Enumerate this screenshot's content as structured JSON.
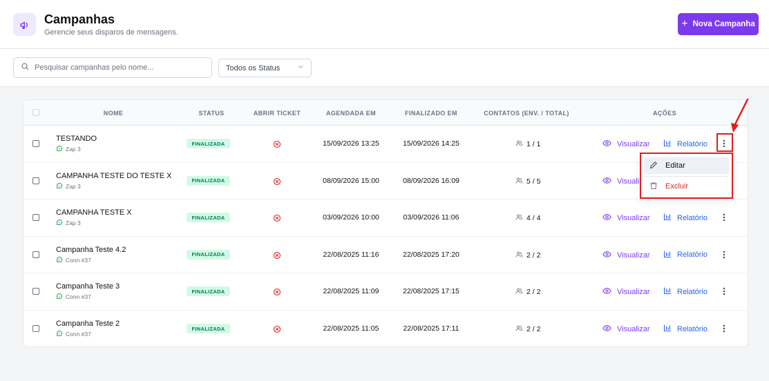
{
  "header": {
    "title": "Campanhas",
    "subtitle": "Gerencie seus disparos de mensagens.",
    "new_button": "Nova Campanha",
    "plus": "+"
  },
  "filters": {
    "search_placeholder": "Pesquisar campanhas pelo nome...",
    "status_value": "Todos os Status"
  },
  "table": {
    "columns": [
      "NOME",
      "STATUS",
      "ABRIR TICKET",
      "AGENDADA EM",
      "FINALIZADO EM",
      "CONTATOS (ENV. / TOTAL)",
      "AÇÕES"
    ],
    "view_label": "Visualizar",
    "report_label": "Relatório",
    "rows": [
      {
        "name": "TESTANDO",
        "connection": "Zap 3",
        "status": "FINALIZADA",
        "scheduled": "15/09/2026 13:25",
        "finished": "15/09/2026 14:25",
        "contacts": "1 / 1"
      },
      {
        "name": "CAMPANHA TESTE DO TESTE X",
        "connection": "Zap 3",
        "status": "FINALIZADA",
        "scheduled": "08/09/2026 15:00",
        "finished": "08/09/2026 16:09",
        "contacts": "5 / 5"
      },
      {
        "name": "CAMPANHA TESTE X",
        "connection": "Zap 3",
        "status": "FINALIZADA",
        "scheduled": "03/09/2026 10:00",
        "finished": "03/09/2026 11:06",
        "contacts": "4 / 4"
      },
      {
        "name": "Campanha Teste 4.2",
        "connection": "Conn #37",
        "status": "FINALIZADA",
        "scheduled": "22/08/2025 11:16",
        "finished": "22/08/2025 17:20",
        "contacts": "2 / 2"
      },
      {
        "name": "Campanha Teste 3",
        "connection": "Conn #37",
        "status": "FINALIZADA",
        "scheduled": "22/08/2025 11:09",
        "finished": "22/08/2025 17:15",
        "contacts": "2 / 2"
      },
      {
        "name": "Campanha Teste 2",
        "connection": "Conn #37",
        "status": "FINALIZADA",
        "scheduled": "22/08/2025 11:05",
        "finished": "22/08/2025 17:11",
        "contacts": "2 / 2"
      }
    ]
  },
  "menu": {
    "edit": "Editar",
    "delete": "Excluir"
  },
  "colors": {
    "accent": "#7c3aed",
    "report": "#2563eb",
    "success_bg": "#d1fae5",
    "success_text": "#047857",
    "danger": "#dc2626",
    "annotation": "#e11d1d"
  },
  "icons": {
    "header": "megaphone-icon",
    "search": "search-icon",
    "select": "chevron-down-icon",
    "connection": "whatsapp-icon",
    "ticket": "x-circle-icon",
    "contacts": "users-icon",
    "view": "eye-icon",
    "report": "bar-chart-icon",
    "more": "dots-vertical-icon",
    "edit": "pencil-icon",
    "delete": "trash-icon"
  }
}
